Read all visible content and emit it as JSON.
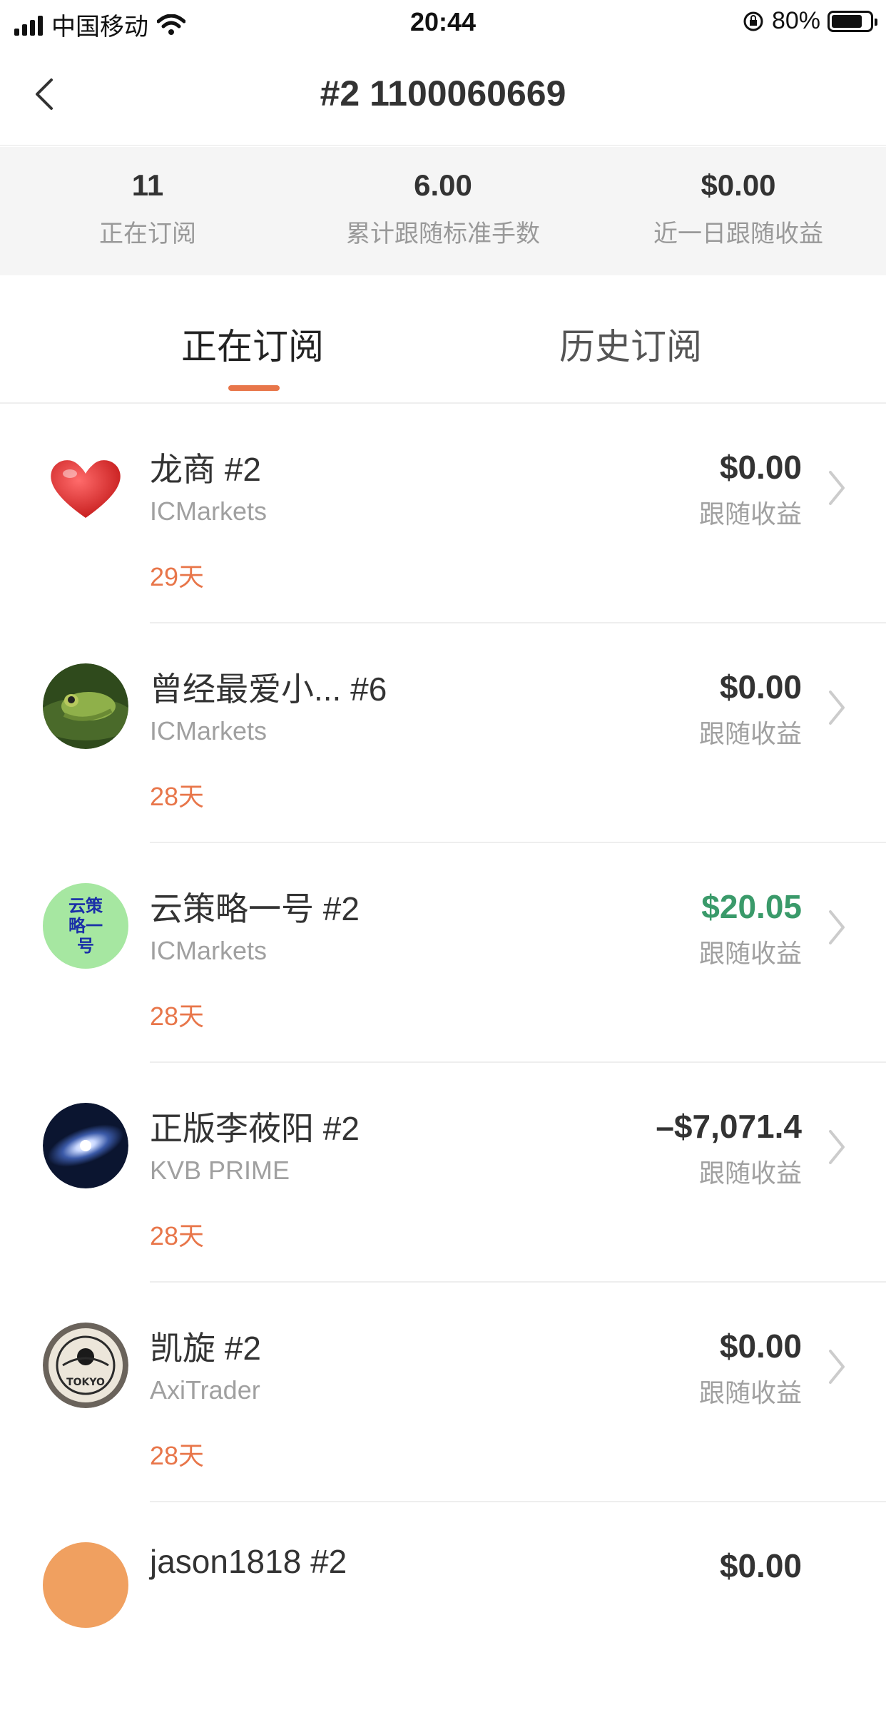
{
  "status_bar": {
    "carrier": "中国移动",
    "time": "20:44",
    "battery": "80%",
    "battery_level": 0.8
  },
  "nav": {
    "title": "#2 1100060669"
  },
  "stats": [
    {
      "value": "11",
      "label": "正在订阅"
    },
    {
      "value": "6.00",
      "label": "累计跟随标准手数"
    },
    {
      "value": "$0.00",
      "label": "近一日跟随收益"
    }
  ],
  "tabs": [
    {
      "label": "正在订阅",
      "active": true
    },
    {
      "label": "历史订阅",
      "active": false
    }
  ],
  "profit_label": "跟随收益",
  "avatar_text": "云策略一号",
  "colors": {
    "accent": "#e8764a",
    "positive": "#3a9a6a",
    "muted": "#a0a0a0",
    "stats_bg": "#f5f5f5"
  },
  "items": [
    {
      "name": "龙商 #2",
      "broker": "ICMarkets",
      "days": "29天",
      "profit": "$0.00",
      "profit_label": "跟随收益",
      "avatar": "heart-icon"
    },
    {
      "name": "曾经最爱小... #6",
      "broker": "ICMarkets",
      "days": "28天",
      "profit": "$0.00",
      "profit_label": "跟随收益",
      "avatar": "frog-photo"
    },
    {
      "name": "云策略一号 #2",
      "broker": "ICMarkets",
      "days": "28天",
      "profit": "$20.05",
      "profit_label": "跟随收益",
      "avatar": "text-avatar"
    },
    {
      "name": "正版李莜阳 #2",
      "broker": "KVB PRIME",
      "days": "28天",
      "profit": "–$7,071.4",
      "profit_label": "跟随收益",
      "avatar": "galaxy-photo"
    },
    {
      "name": "凯旋 #2",
      "broker": "AxiTrader",
      "days": "28天",
      "profit": "$0.00",
      "profit_label": "跟随收益",
      "avatar": "tokyo-logo"
    },
    {
      "name": "jason1818 #2",
      "broker": "",
      "days": "",
      "profit": "$0.00",
      "profit_label": "",
      "avatar": "letter-avatar"
    }
  ]
}
